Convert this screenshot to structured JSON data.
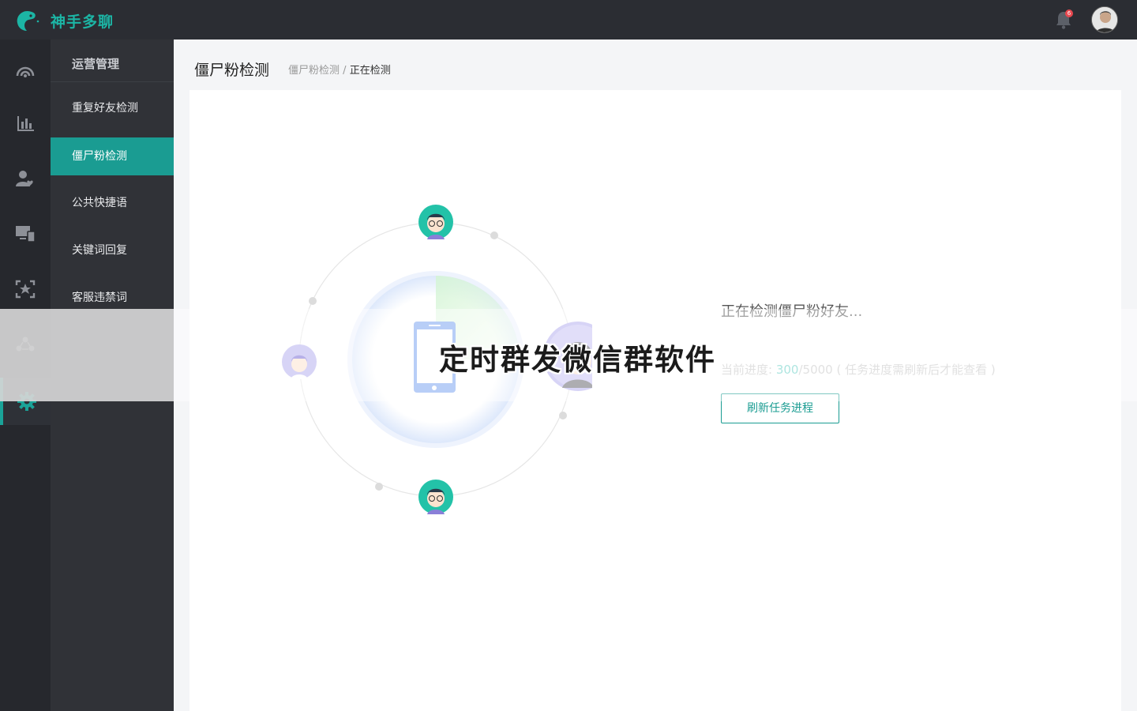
{
  "app": {
    "brand": "神手多聊"
  },
  "header": {
    "notification_count": "6"
  },
  "submenu": {
    "title": "运营管理",
    "items": [
      {
        "label": "重复好友检测"
      },
      {
        "label": "僵尸粉检测"
      },
      {
        "label": "公共快捷语"
      },
      {
        "label": "关键词回复"
      },
      {
        "label": "客服违禁词"
      }
    ]
  },
  "rail": {
    "icons": [
      "dashboard-icon",
      "bar-chart-icon",
      "user-heart-icon",
      "devices-icon",
      "star-scan-icon",
      "group-icon",
      "gear-icon"
    ]
  },
  "page": {
    "title": "僵尸粉检测",
    "breadcrumb": {
      "parent": "僵尸粉检测",
      "separator": "/",
      "current": "正在检测"
    }
  },
  "status": {
    "title": "正在检测僵尸粉好友...",
    "progress_label": "当前进度:",
    "progress_current": "300",
    "progress_sep": "/",
    "progress_total": "5000",
    "progress_note": "( 任务进度需刷新后才能查看 )",
    "refresh_button": "刷新任务进程"
  },
  "overlay": {
    "watermark": "定时群发微信群软件"
  },
  "colors": {
    "accent": "#1a9c92",
    "brand": "#1cb5a5",
    "topbar": "#2b2d33",
    "badge": "#e8484f"
  }
}
